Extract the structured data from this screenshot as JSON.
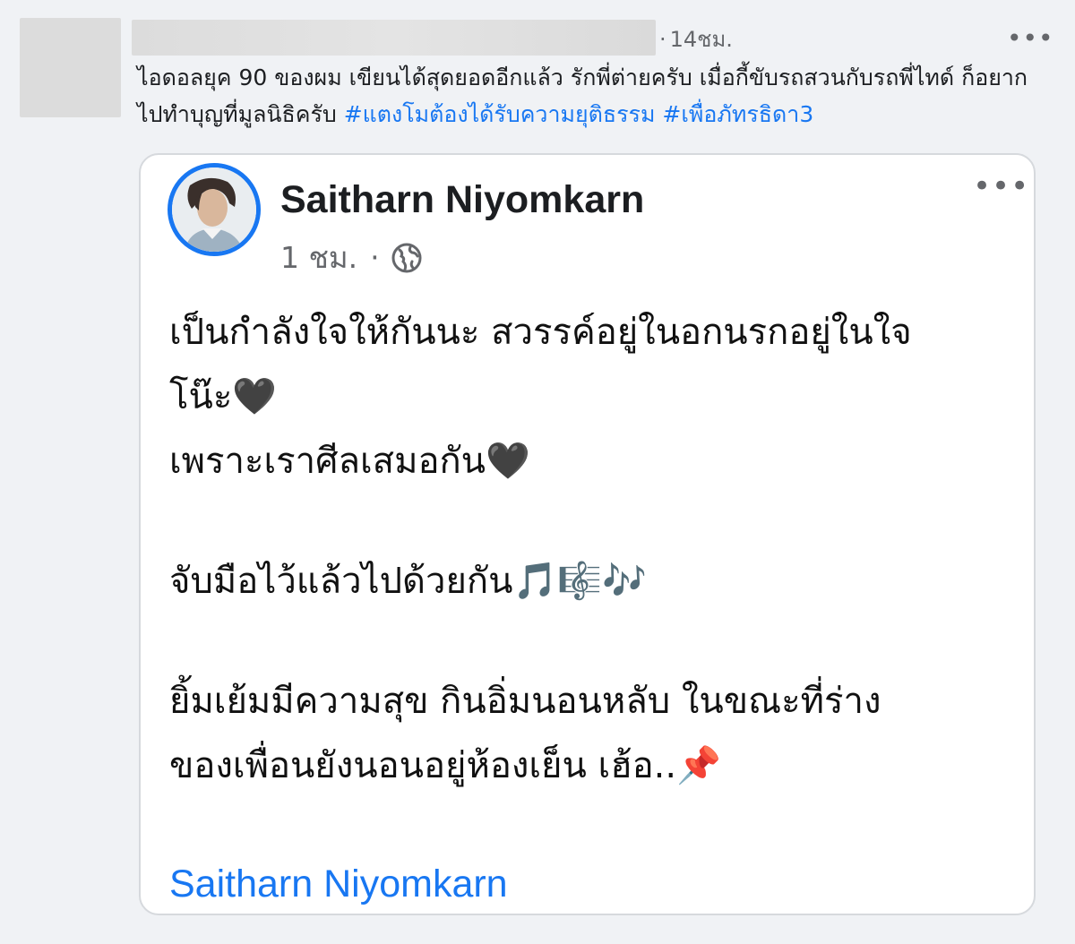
{
  "post": {
    "time": "14ชม.",
    "time_separator": "·",
    "more_label": "•••",
    "text_plain": "ไอดอลยุค 90 ของผม เขียนได้สุดยอดอีกแล้ว รักพี่ต่ายครับ เมื่อกี้ขับรถสวนกับรถพี่ไทด์ ก็อยากไปทำบุญที่มูลนิธิครับ ",
    "hashtags": [
      "#แตงโมต้องได้รับความยุติธรรม",
      "#เพื่อภัทรธิดา3"
    ]
  },
  "shared": {
    "author": "Saitharn Niyomkarn",
    "time": "1 ชม.",
    "time_separator": "·",
    "more_label": "•••",
    "privacy_icon": "globe-icon",
    "lines": [
      "เป็นกำลังใจให้กันนะ สวรรค์อยู่ในอกนรกอยู่ในใจ",
      "โน๊ะ🖤",
      "เพราะเราศีลเสมอกัน🖤",
      "จับมือไว้แล้วไปด้วยกัน🎵🎼🎶",
      "ยิ้มเย้มมีความสุข กินอิ่มนอนหลับ  ในขณะที่ร่าง",
      "ของเพื่อนยังนอนอยู่ห้องเย็น เฮ้อ..📌"
    ],
    "footer_link": "Saitharn Niyomkarn"
  },
  "colors": {
    "background": "#f0f2f5",
    "link_blue": "#1877f2",
    "muted_text": "#65676b"
  }
}
